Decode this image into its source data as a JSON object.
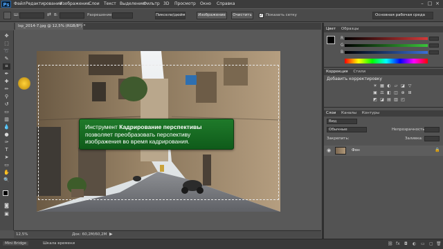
{
  "menubar": {
    "logo": "Ps",
    "items": [
      "Файл",
      "Редактирование",
      "Изображение",
      "Слои",
      "Текст",
      "Выделение",
      "Фильтр",
      "3D",
      "Просмотр",
      "Окно",
      "Справка"
    ],
    "window_controls": [
      "–",
      "□",
      "×"
    ]
  },
  "options_bar": {
    "w_label": "Ш:",
    "swap_symbol": "⇄",
    "h_label": "В:",
    "resolution_label": "Разрешение:",
    "units_value": "Пиксели/дюйм",
    "image_button": "Изображение",
    "clear_button": "Очистить",
    "show_grid_label": "Показать сетку",
    "show_grid_checked": true,
    "workspace_value": "Основная рабочая среда"
  },
  "document": {
    "tab_title": "Isp_2014-7.jpg @ 12,5% (RGB/8*) *",
    "zoom": "12,5%",
    "doc_size": "Док: 60,2M/60,2M"
  },
  "callout": {
    "text_prefix": "Инструмент ",
    "text_bold": "Кадрирование перспективы",
    "text_rest": " позволяет преобразовать перспективу изображения во время кадрирования."
  },
  "color_panel": {
    "tabs": [
      "Цвет",
      "Образцы"
    ],
    "channels": [
      "R",
      "G",
      "B"
    ],
    "channel_colors": [
      "#d43a3a",
      "#3ac23a",
      "#3a6fd8"
    ]
  },
  "adjustments_panel": {
    "tabs": [
      "Коррекция",
      "Стили"
    ],
    "add_label": "Добавить корректировку",
    "icons_row1": [
      "☀",
      "▦",
      "◐",
      "▱",
      "◪",
      "▽"
    ],
    "icons_row2": [
      "▣",
      "⚖",
      "◧",
      "◫",
      "⊕",
      "⊞"
    ],
    "icons_row3": [
      "◩",
      "◪",
      "▤",
      "▥",
      "◰"
    ]
  },
  "layers_panel": {
    "tabs": [
      "Слои",
      "Каналы",
      "Контуры"
    ],
    "kind_label": "Вид",
    "blend_mode": "Обычные",
    "opacity_label": "Непрозрачность:",
    "lock_label": "Закрепить:",
    "fill_label": "Заливка:",
    "layer_name": "Фон"
  },
  "bottom_bar": {
    "tabs": [
      "Mini Bridge",
      "Шкала времени"
    ]
  }
}
